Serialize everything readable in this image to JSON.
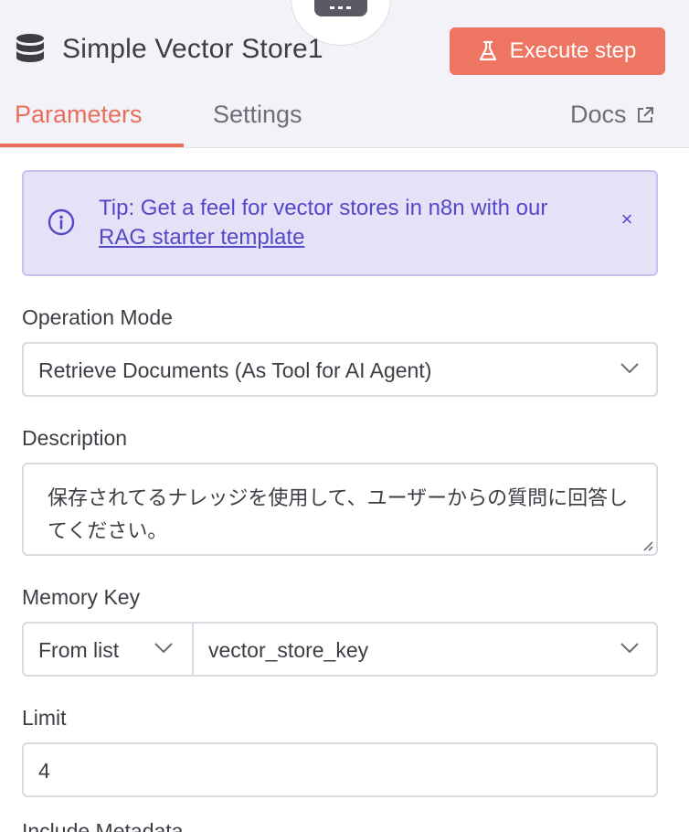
{
  "header": {
    "node_title": "Simple Vector Store1",
    "execute_label": "Execute step",
    "accent": "#ef7563"
  },
  "tabs": {
    "parameters": "Parameters",
    "settings": "Settings",
    "docs": "Docs"
  },
  "tip": {
    "text": "Tip: Get a feel for vector stores in n8n with our",
    "link": "RAG starter template",
    "close": "×"
  },
  "operation_mode": {
    "label": "Operation Mode",
    "value": "Retrieve Documents (As Tool for AI Agent)"
  },
  "description": {
    "label": "Description",
    "value": "保存されてるナレッジを使用して、ユーザーからの質問に回答してください。"
  },
  "memory_key": {
    "label": "Memory Key",
    "mode": "From list",
    "value": "vector_store_key"
  },
  "limit": {
    "label": "Limit",
    "value": "4"
  },
  "include_metadata": {
    "label": "Include Metadata"
  }
}
